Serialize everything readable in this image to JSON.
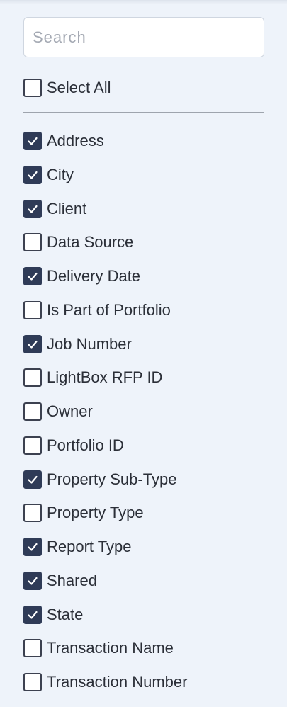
{
  "search": {
    "placeholder": "Search",
    "value": ""
  },
  "select_all": {
    "label": "Select All",
    "checked": false
  },
  "columns": [
    {
      "label": "Address",
      "checked": true
    },
    {
      "label": "City",
      "checked": true
    },
    {
      "label": "Client",
      "checked": true
    },
    {
      "label": "Data Source",
      "checked": false
    },
    {
      "label": "Delivery Date",
      "checked": true
    },
    {
      "label": "Is Part of Portfolio",
      "checked": false
    },
    {
      "label": "Job Number",
      "checked": true
    },
    {
      "label": "LightBox RFP ID",
      "checked": false
    },
    {
      "label": "Owner",
      "checked": false
    },
    {
      "label": "Portfolio ID",
      "checked": false
    },
    {
      "label": "Property Sub-Type",
      "checked": true
    },
    {
      "label": "Property Type",
      "checked": false
    },
    {
      "label": "Report Type",
      "checked": true
    },
    {
      "label": "Shared",
      "checked": true
    },
    {
      "label": "State",
      "checked": true
    },
    {
      "label": "Transaction Name",
      "checked": false
    },
    {
      "label": "Transaction Number",
      "checked": false
    }
  ],
  "colors": {
    "panel_bg": "#eef3fa",
    "checkbox_checked": "#2f3b57",
    "checkbox_border": "#3c4150",
    "text": "#2b2f38"
  },
  "icons": {
    "check": "checkmark-icon"
  }
}
